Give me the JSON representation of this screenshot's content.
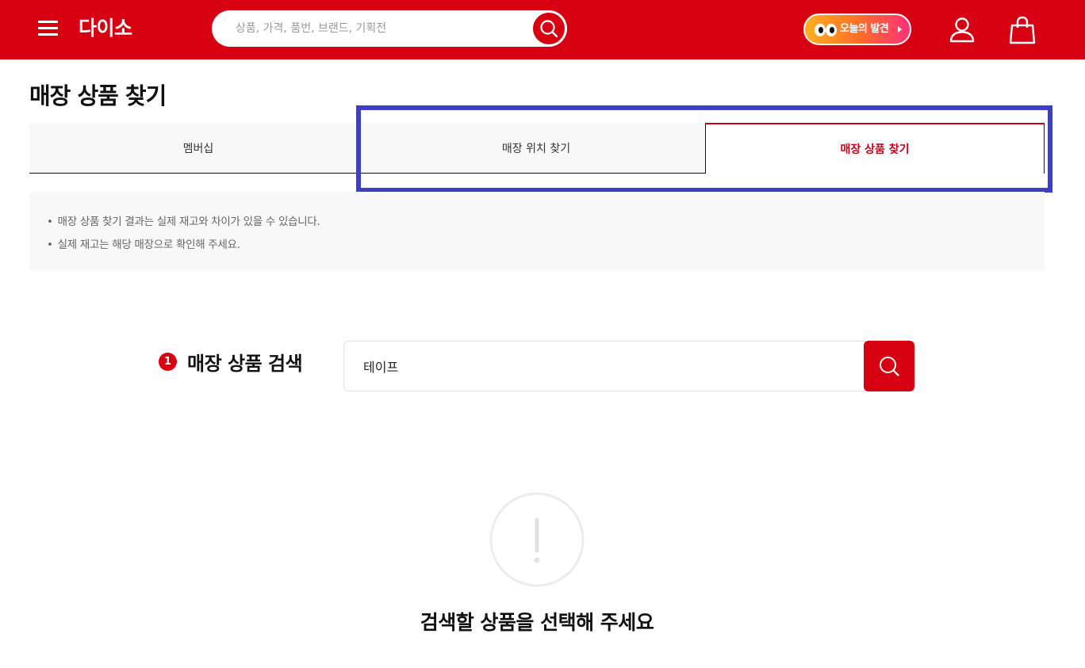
{
  "header": {
    "logo": "다이소",
    "search_placeholder": "상품, 가격, 품번, 브랜드, 기획전",
    "today_pill": "오늘의 발견",
    "brand_color": "#d70012",
    "icons": [
      "menu-icon",
      "search-icon",
      "eyes-icon",
      "user-icon",
      "cart-icon"
    ]
  },
  "page": {
    "title": "매장 상품 찾기"
  },
  "tabs": [
    {
      "label": "멤버십",
      "active": false
    },
    {
      "label": "매장 위치 찾기",
      "active": false
    },
    {
      "label": "매장 상품 찾기",
      "active": true
    }
  ],
  "notice": {
    "items": [
      "매장 상품 찾기 결과는 실제 재고와 차이가 있을 수 있습니다.",
      "실제 재고는 해당 매장으로 확인해 주세요."
    ]
  },
  "product_search": {
    "step": "1",
    "label": "매장 상품 검색",
    "value": "테이프"
  },
  "empty_state": {
    "message": "검색할 상품을 선택해 주세요",
    "icon": "exclamation-circle-icon"
  },
  "annotation": {
    "highlight_color": "#3d3fc6"
  }
}
